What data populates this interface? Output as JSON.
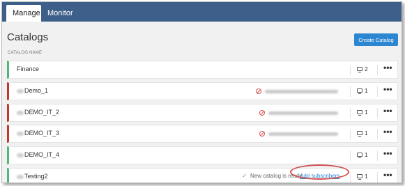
{
  "tabs": [
    {
      "label": "Manage",
      "active": true
    },
    {
      "label": "Monitor",
      "active": false
    }
  ],
  "page": {
    "title": "Catalogs",
    "create_button": "Create Catalog",
    "column_header": "CATALOG NAME"
  },
  "catalogs": [
    {
      "name": "Finance",
      "status": "ok",
      "count": "2",
      "menu": "•••"
    },
    {
      "name": "Demo_1",
      "status": "error",
      "count": "1",
      "menu": "•••"
    },
    {
      "name": "DEMO_IT_2",
      "status": "error",
      "count": "1",
      "menu": "•••"
    },
    {
      "name": "DEMO_IT_3",
      "status": "error",
      "count": "1",
      "menu": "•••"
    },
    {
      "name": "DEMO_IT_4",
      "status": "ok",
      "count": "1",
      "menu": "•••"
    },
    {
      "name": "Testing2",
      "status": "ok",
      "count": "1",
      "menu": "•••",
      "status_text": "New catalog is ready.",
      "status_link": "Add subscribers",
      "check": "✓"
    }
  ],
  "colors": {
    "header_bg": "#3e5f8a",
    "accent_blue": "#2c86d2",
    "ok_green": "#4eb879",
    "error_red": "#c0392b",
    "highlight": "#d05050"
  },
  "icons": [
    "desktop-icon",
    "error-circle-icon",
    "check-icon",
    "more-options-icon"
  ]
}
